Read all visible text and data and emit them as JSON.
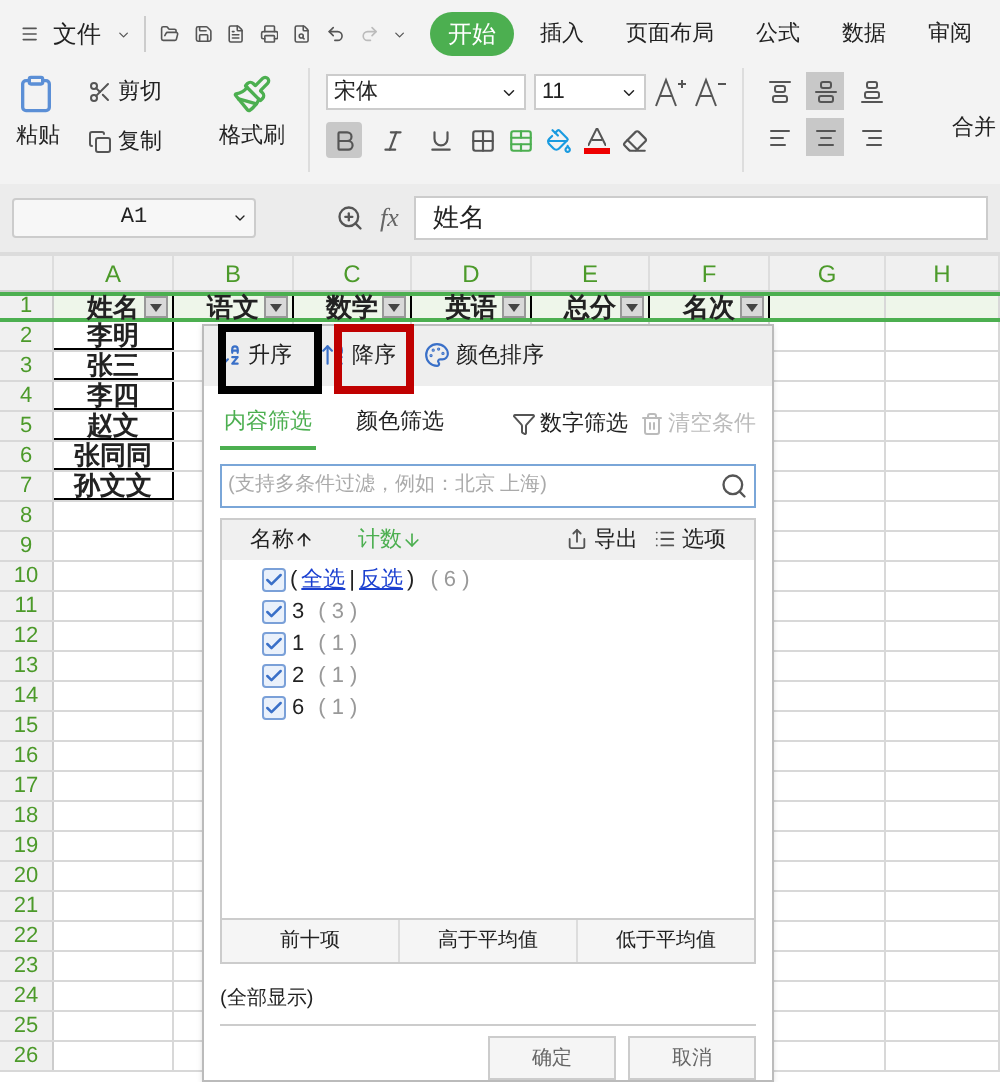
{
  "toolbar": {
    "file_menu": "文件",
    "tabs": [
      {
        "label": "开始",
        "selected": true
      },
      {
        "label": "插入",
        "selected": false
      },
      {
        "label": "页面布局",
        "selected": false
      },
      {
        "label": "公式",
        "selected": false
      },
      {
        "label": "数据",
        "selected": false
      },
      {
        "label": "审阅",
        "selected": false
      }
    ],
    "paste": "粘贴",
    "cut": "剪切",
    "copy": "复制",
    "format_painter": "格式刷",
    "font_name": "宋体",
    "font_size": "11",
    "merge": "合并",
    "format_buttons": [
      {
        "kind": "bold",
        "on": true
      },
      {
        "kind": "italic",
        "on": false
      },
      {
        "kind": "underline",
        "on": false
      }
    ],
    "align_buttons": [
      {
        "kind": "top",
        "on": false
      },
      {
        "kind": "middle",
        "on": true
      },
      {
        "kind": "bottom",
        "on": false
      },
      {
        "kind": "left",
        "on": false
      },
      {
        "kind": "center",
        "on": true
      },
      {
        "kind": "right",
        "on": false
      }
    ]
  },
  "formula_bar": {
    "cell_ref": "A1",
    "fx": "fx",
    "value": "姓名"
  },
  "sheet": {
    "columns": [
      "A",
      "B",
      "C",
      "D",
      "E",
      "F",
      "G",
      "H"
    ],
    "row_numbers": [
      "1",
      "2",
      "3",
      "4",
      "5",
      "6",
      "7",
      "8",
      "9",
      "10",
      "11",
      "12",
      "13",
      "14",
      "15",
      "16",
      "17",
      "18",
      "19",
      "20",
      "21",
      "22",
      "23",
      "24",
      "25",
      "26"
    ],
    "header_row": [
      "姓名",
      "语文",
      "数学",
      "英语",
      "总分",
      "名次"
    ],
    "names": [
      "李明",
      "张三",
      "李四",
      "赵文",
      "张同同",
      "孙文文"
    ]
  },
  "filter_popup": {
    "sort_buttons": [
      {
        "kind": "asc",
        "label": "升序"
      },
      {
        "kind": "desc",
        "label": "降序"
      },
      {
        "kind": "color",
        "label": "颜色排序"
      }
    ],
    "tabs": [
      {
        "label": "内容筛选",
        "selected": true
      },
      {
        "label": "颜色筛选",
        "selected": false
      }
    ],
    "number_filter": "数字筛选",
    "clear": "清空条件",
    "search": {
      "placeholder": "(支持多条件过滤，例如：北京 上海)"
    },
    "list_header": {
      "name": "名称",
      "count": "计数",
      "export": "导出",
      "options": "选项"
    },
    "select_all": {
      "open": "(",
      "all": "全选",
      "sep": "|",
      "invert": "反选",
      "close": ")",
      "count": "( 6 )",
      "checked": true
    },
    "items": [
      {
        "label": "3",
        "count": "( 3 )",
        "checked": true
      },
      {
        "label": "1",
        "count": "( 1 )",
        "checked": true
      },
      {
        "label": "2",
        "count": "( 1 )",
        "checked": true
      },
      {
        "label": "6",
        "count": "( 1 )",
        "checked": true
      }
    ],
    "quick_buttons": [
      "前十项",
      "高于平均值",
      "低于平均值"
    ],
    "status": "(全部显示)",
    "ok": "确定",
    "cancel": "取消"
  },
  "annotations": [
    {
      "color": "#000000"
    },
    {
      "color": "#c00000"
    }
  ]
}
